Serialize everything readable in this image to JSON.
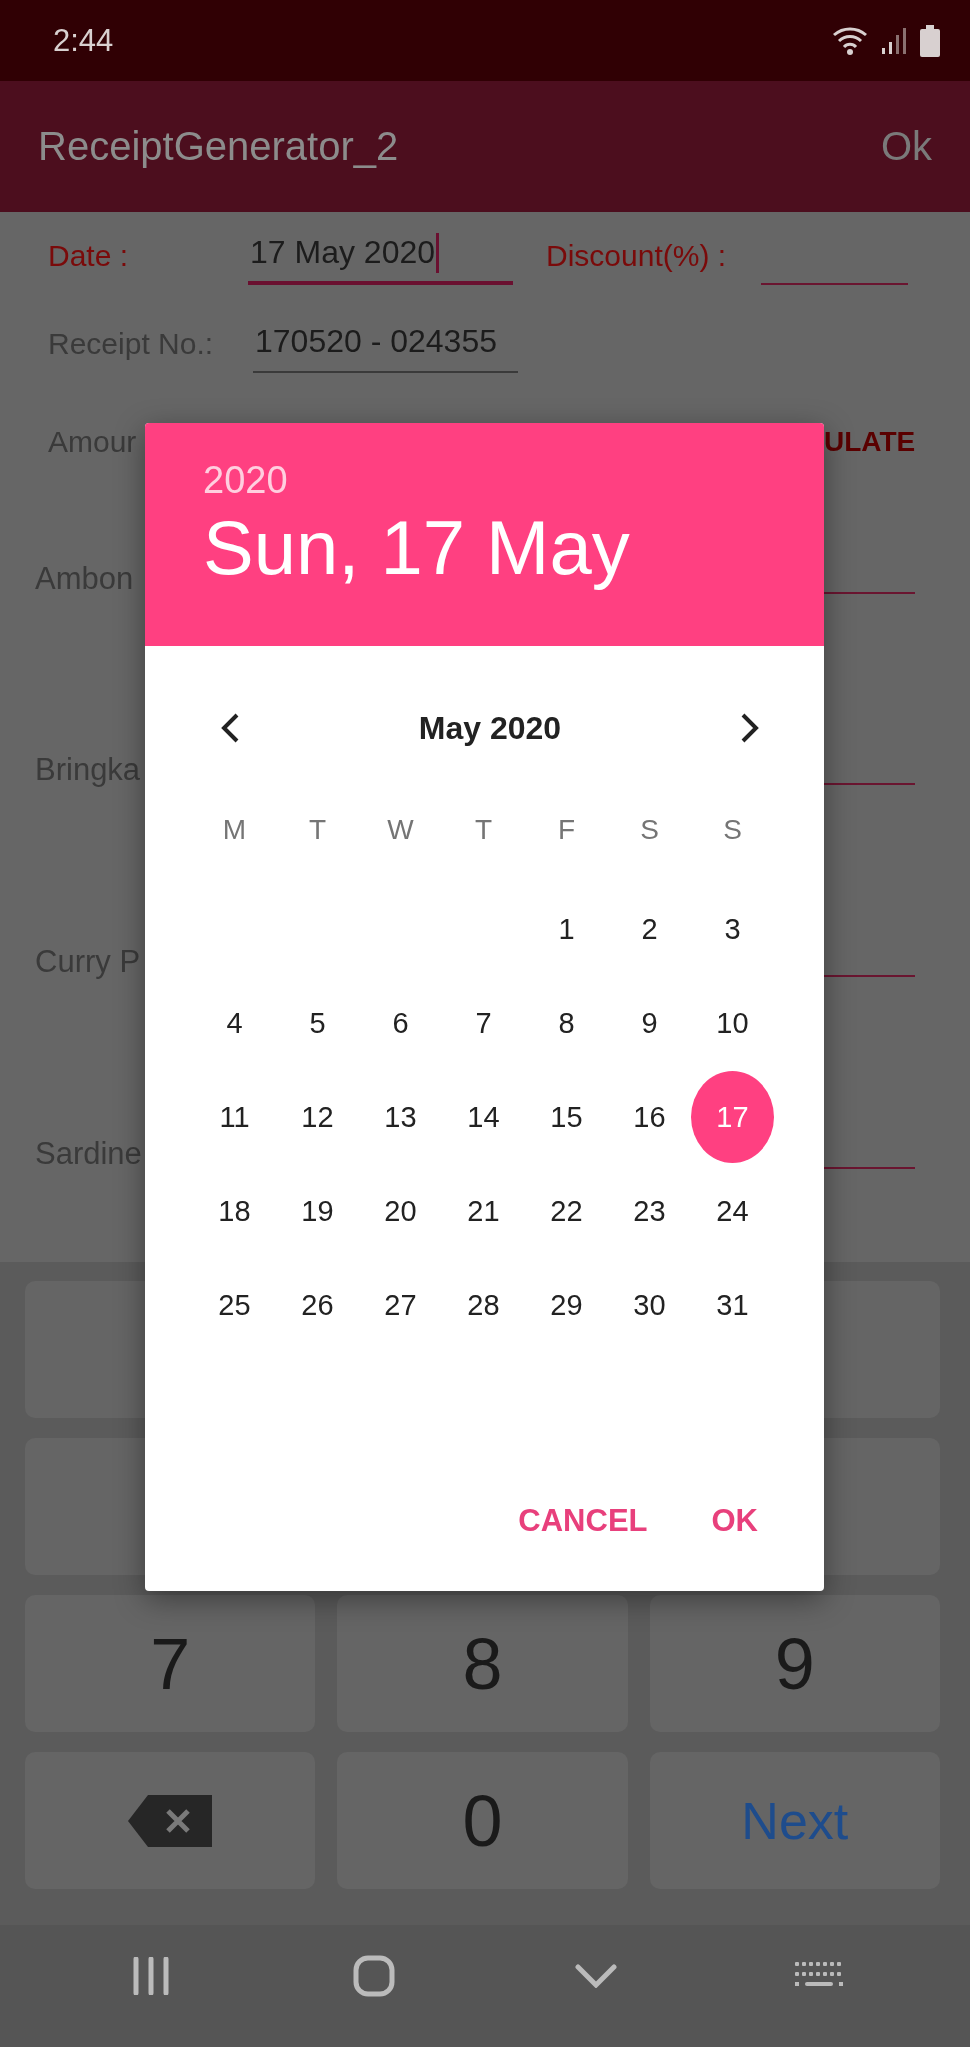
{
  "status_bar": {
    "time": "2:44"
  },
  "app_bar": {
    "title": "ReceiptGenerator_2",
    "action": "Ok"
  },
  "form": {
    "date": {
      "label": "Date :",
      "value": "17 May 2020",
      "focused": true
    },
    "discount": {
      "label": "Discount(%) :"
    },
    "receipt": {
      "label": "Receipt No.:",
      "value": "170520 - 024355"
    },
    "amount_label": "Amour",
    "calculate_button": "ULATE",
    "items": [
      {
        "label": "Ambon"
      },
      {
        "label": "Bringka"
      },
      {
        "label": "Curry P"
      },
      {
        "label": "Sardine"
      }
    ]
  },
  "date_picker": {
    "year": "2020",
    "date": "Sun, 17 May",
    "month": "May 2020",
    "weekdays": [
      "M",
      "T",
      "W",
      "T",
      "F",
      "S",
      "S"
    ],
    "weeks": [
      [
        {
          "label": "1",
          "selected": false
        },
        {
          "label": "2",
          "selected": false
        },
        {
          "label": "3",
          "selected": false
        }
      ],
      [
        {
          "label": "4",
          "selected": false
        },
        {
          "label": "5",
          "selected": false
        },
        {
          "label": "6",
          "selected": false
        },
        {
          "label": "7",
          "selected": false
        },
        {
          "label": "8",
          "selected": false
        },
        {
          "label": "9",
          "selected": false
        },
        {
          "label": "10",
          "selected": false
        }
      ],
      [
        {
          "label": "11",
          "selected": false
        },
        {
          "label": "12",
          "selected": false
        },
        {
          "label": "13",
          "selected": false
        },
        {
          "label": "14",
          "selected": false
        },
        {
          "label": "15",
          "selected": false
        },
        {
          "label": "16",
          "selected": false
        },
        {
          "label": "17",
          "selected": true
        }
      ],
      [
        {
          "label": "18",
          "selected": false
        },
        {
          "label": "19",
          "selected": false
        },
        {
          "label": "20",
          "selected": false
        },
        {
          "label": "21",
          "selected": false
        },
        {
          "label": "22",
          "selected": false
        },
        {
          "label": "23",
          "selected": false
        },
        {
          "label": "24",
          "selected": false
        }
      ],
      [
        {
          "label": "25",
          "selected": false
        },
        {
          "label": "26",
          "selected": false
        },
        {
          "label": "27",
          "selected": false
        },
        {
          "label": "28",
          "selected": false
        },
        {
          "label": "29",
          "selected": false
        },
        {
          "label": "30",
          "selected": false
        },
        {
          "label": "31",
          "selected": false
        }
      ]
    ],
    "buttons": [
      "CANCEL",
      "OK"
    ]
  },
  "keyboard": {
    "rows": [
      [
        {
          "kind": "blank"
        },
        {
          "kind": "blank"
        }
      ],
      [
        {
          "kind": "blank"
        },
        {
          "kind": "blank"
        }
      ],
      [
        {
          "kind": "digit",
          "label": "7"
        },
        {
          "kind": "digit",
          "label": "8"
        },
        {
          "kind": "digit",
          "label": "9"
        }
      ],
      [
        {
          "kind": "backspace"
        },
        {
          "kind": "digit",
          "label": "0"
        },
        {
          "kind": "action",
          "label": "Next"
        }
      ]
    ]
  }
}
